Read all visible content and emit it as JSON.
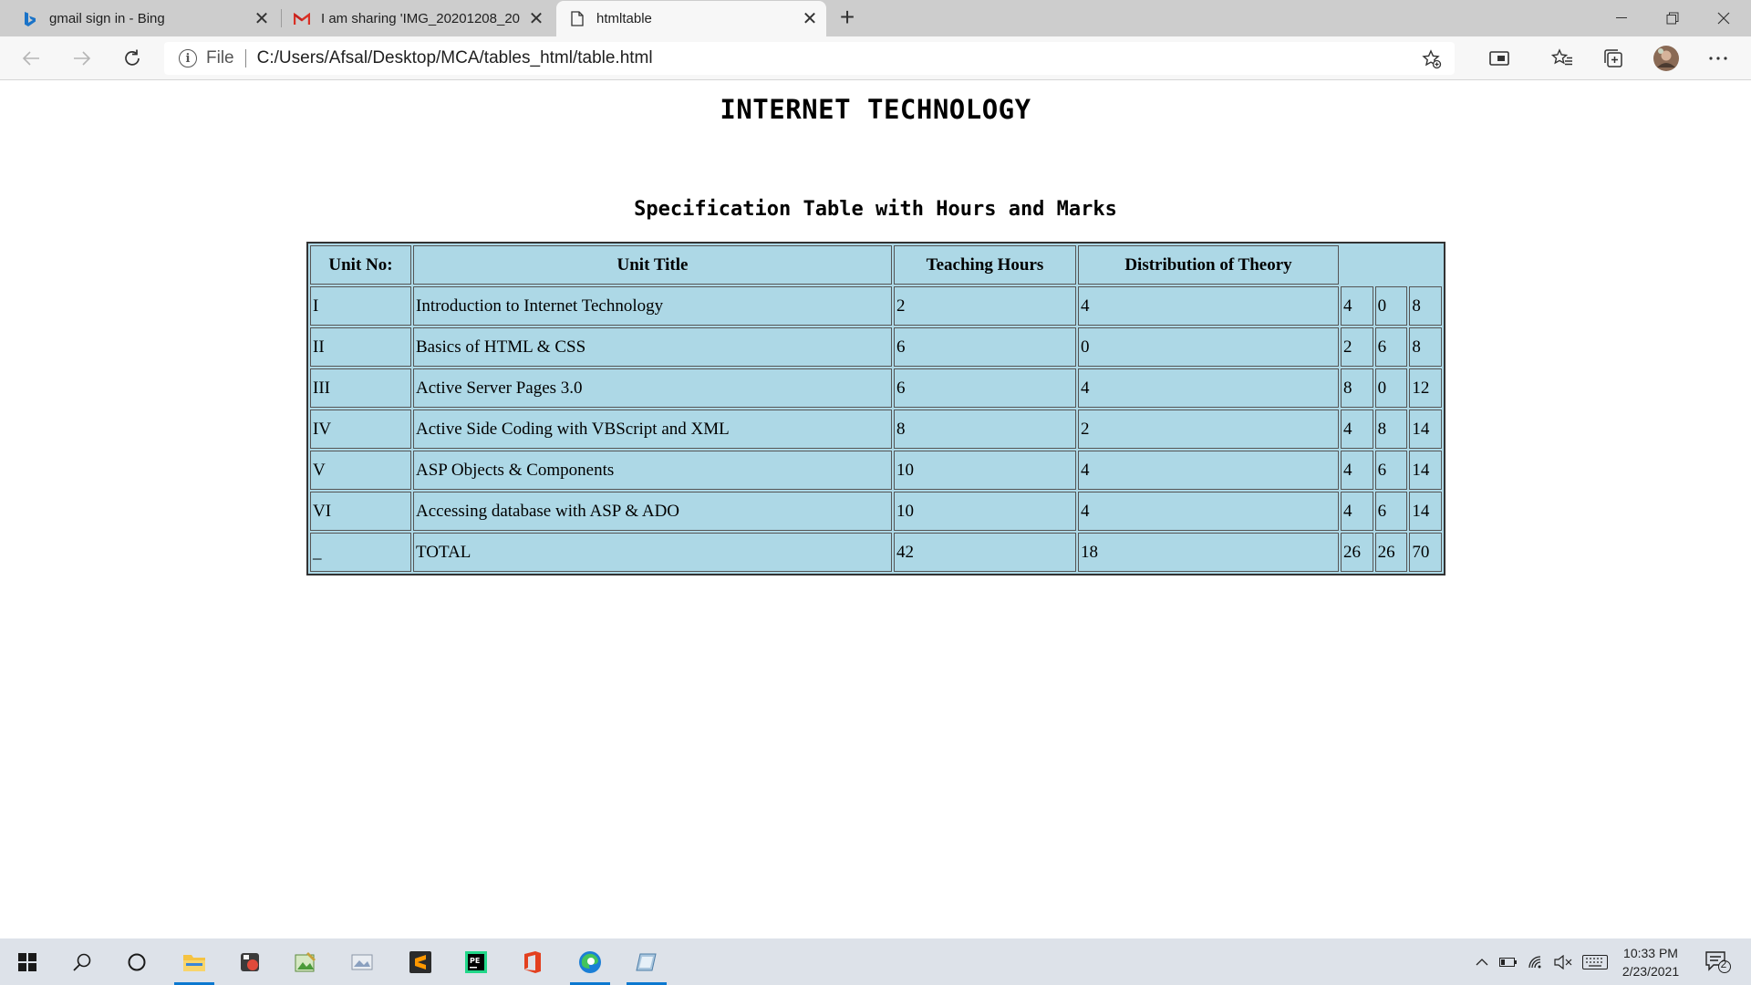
{
  "browser": {
    "tabs": [
      {
        "title": "gmail sign in - Bing",
        "icon": "bing-icon",
        "active": false
      },
      {
        "title": "I am sharing 'IMG_20201208_20",
        "icon": "gmail-icon",
        "active": false
      },
      {
        "title": "htmltable",
        "icon": "file-icon",
        "active": true
      }
    ],
    "address": {
      "scheme_label": "File",
      "url": "C:/Users/Afsal/Desktop/MCA/tables_html/table.html"
    }
  },
  "page": {
    "title": "INTERNET TECHNOLOGY",
    "caption": "Specification Table with Hours and Marks",
    "table": {
      "headers": [
        "Unit No:",
        "Unit Title",
        "Teaching Hours",
        "Distribution of Theory"
      ],
      "rows": [
        [
          "I",
          "Introduction to Internet Technology",
          "2",
          "4",
          "4",
          "0",
          "8"
        ],
        [
          "II",
          "Basics of HTML & CSS",
          "6",
          "0",
          "2",
          "6",
          "8"
        ],
        [
          "III",
          "Active Server Pages 3.0",
          "6",
          "4",
          "8",
          "0",
          "12"
        ],
        [
          "IV",
          "Active Side Coding with VBScript and XML",
          "8",
          "2",
          "4",
          "8",
          "14"
        ],
        [
          "V",
          "ASP Objects & Components",
          "10",
          "4",
          "4",
          "6",
          "14"
        ],
        [
          "VI",
          "Accessing database with ASP & ADO",
          "10",
          "4",
          "4",
          "6",
          "14"
        ],
        [
          "_",
          "TOTAL",
          "42",
          "18",
          "26",
          "26",
          "70"
        ]
      ],
      "background_color": "#add8e6"
    }
  },
  "taskbar": {
    "apps": [
      "windows-start-icon",
      "search-icon",
      "cortana-icon",
      "file-explorer-icon",
      "app-icon",
      "app-icon",
      "app-icon",
      "sublime-text-icon",
      "pycharm-icon",
      "office-icon",
      "edge-icon",
      "app-icon"
    ],
    "clock": {
      "time": "10:33 PM",
      "date": "2/23/2021"
    },
    "notification_count": "2"
  }
}
